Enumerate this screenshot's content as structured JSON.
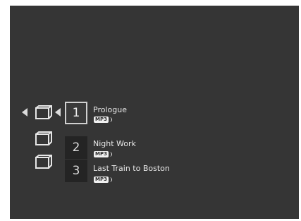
{
  "navigation": {
    "prev_icon": "left-arrow-icon",
    "next_icon": "left-arrow-icon"
  },
  "folders": [
    {
      "icon": "folder-icon"
    },
    {
      "icon": "folder-icon"
    },
    {
      "icon": "folder-icon"
    }
  ],
  "tracks": [
    {
      "number": "1",
      "title": "Prologue",
      "format": "MP3",
      "selected": true
    },
    {
      "number": "2",
      "title": "Night Work",
      "format": "MP3",
      "selected": false
    },
    {
      "number": "3",
      "title": "Last Train to Boston",
      "format": "MP3",
      "selected": false
    }
  ],
  "colors": {
    "background": "#353535",
    "text": "#e8e8e8",
    "number_box": "#242424",
    "selected_border": "#d0d0d0"
  }
}
